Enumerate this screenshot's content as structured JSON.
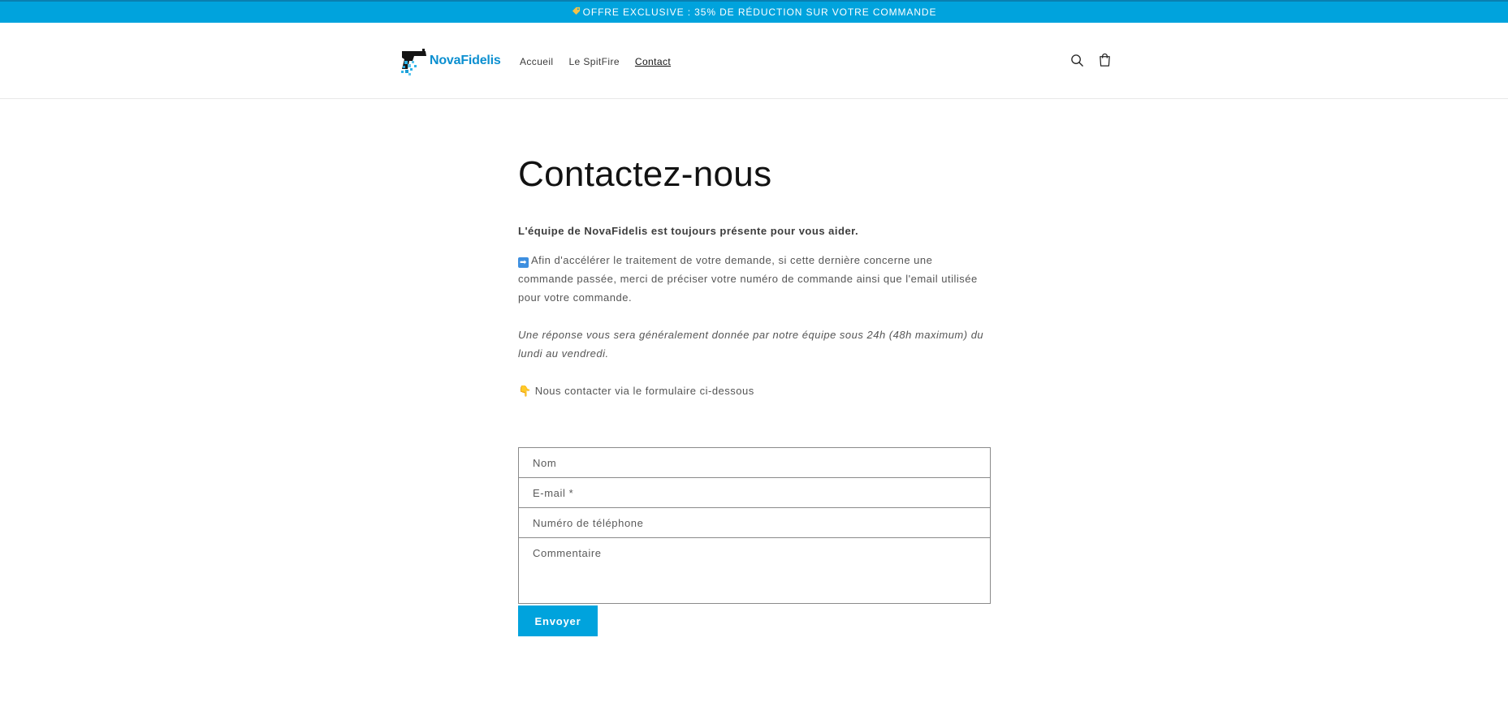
{
  "announcement": {
    "icon": "tag-icon",
    "text": "OFFRE EXCLUSIVE : 35% DE RÉDUCTION SUR VOTRE COMMANDE",
    "bg_color": "#00a3dd"
  },
  "header": {
    "logo_text": "NovaFidelis",
    "nav": [
      {
        "label": "Accueil",
        "active": false
      },
      {
        "label": "Le SpitFire",
        "active": false
      },
      {
        "label": "Contact",
        "active": true
      }
    ],
    "icons": [
      "search-icon",
      "cart-icon"
    ]
  },
  "main": {
    "title": "Contactez-nous",
    "intro": "L'équipe de NovaFidelis est toujours présente pour vous aider.",
    "info_icon": "right-arrow-icon",
    "info": "Afin d'accélérer le traitement de votre demande, si cette dernière concerne une commande passée, merci de préciser votre numéro de commande ainsi que l'email utilisée pour votre commande.",
    "response_note": "Une réponse vous sera généralement donnée par notre équipe sous 24h (48h maximum) du lundi au vendredi.",
    "form_hint_icon": "pointing-down-hand-icon",
    "form_hint": "Nous contacter via le formulaire ci-dessous"
  },
  "form": {
    "name_placeholder": "Nom",
    "email_placeholder": "E-mail *",
    "phone_placeholder": "Numéro de téléphone",
    "comment_placeholder": "Commentaire",
    "submit_label": "Envoyer",
    "accent_color": "#00a3dd"
  }
}
